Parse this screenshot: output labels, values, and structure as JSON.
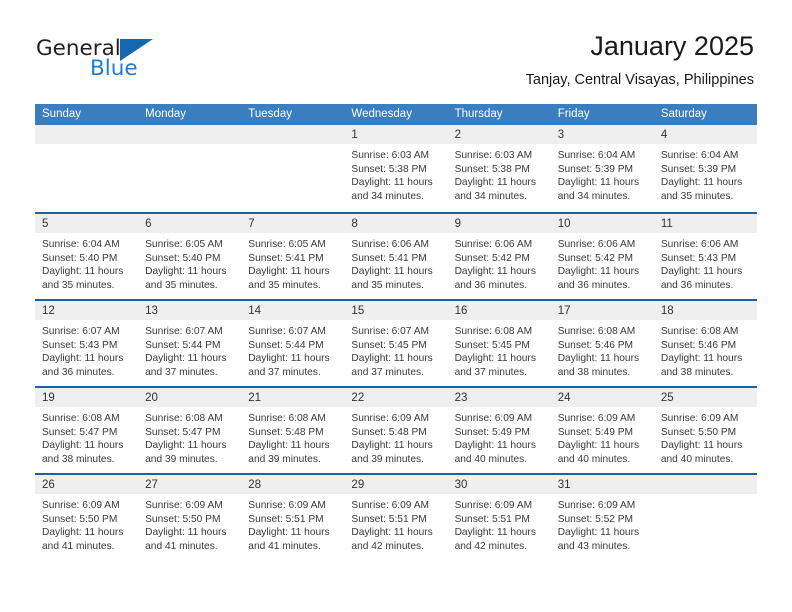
{
  "brand": {
    "name_part1": "General",
    "name_part2": "Blue",
    "accent_color": "#1567b0",
    "blue_text_color": "#1b7fd4"
  },
  "header": {
    "title": "January 2025",
    "subtitle": "Tanjay, Central Visayas, Philippines"
  },
  "theme": {
    "header_bar_color": "#3a7ec0",
    "week_divider_color": "#1f5fa3",
    "day_strip_color": "#efefef"
  },
  "weekdays": [
    "Sunday",
    "Monday",
    "Tuesday",
    "Wednesday",
    "Thursday",
    "Friday",
    "Saturday"
  ],
  "labels": {
    "sunrise_prefix": "Sunrise:",
    "sunset_prefix": "Sunset:",
    "daylight_prefix": "Daylight:"
  },
  "weeks": [
    [
      {
        "day": "",
        "empty": true
      },
      {
        "day": "",
        "empty": true
      },
      {
        "day": "",
        "empty": true
      },
      {
        "day": "1",
        "sunrise": "Sunrise: 6:03 AM",
        "sunset": "Sunset: 5:38 PM",
        "daylight1": "Daylight: 11 hours",
        "daylight2": "and 34 minutes."
      },
      {
        "day": "2",
        "sunrise": "Sunrise: 6:03 AM",
        "sunset": "Sunset: 5:38 PM",
        "daylight1": "Daylight: 11 hours",
        "daylight2": "and 34 minutes."
      },
      {
        "day": "3",
        "sunrise": "Sunrise: 6:04 AM",
        "sunset": "Sunset: 5:39 PM",
        "daylight1": "Daylight: 11 hours",
        "daylight2": "and 34 minutes."
      },
      {
        "day": "4",
        "sunrise": "Sunrise: 6:04 AM",
        "sunset": "Sunset: 5:39 PM",
        "daylight1": "Daylight: 11 hours",
        "daylight2": "and 35 minutes."
      }
    ],
    [
      {
        "day": "5",
        "sunrise": "Sunrise: 6:04 AM",
        "sunset": "Sunset: 5:40 PM",
        "daylight1": "Daylight: 11 hours",
        "daylight2": "and 35 minutes."
      },
      {
        "day": "6",
        "sunrise": "Sunrise: 6:05 AM",
        "sunset": "Sunset: 5:40 PM",
        "daylight1": "Daylight: 11 hours",
        "daylight2": "and 35 minutes."
      },
      {
        "day": "7",
        "sunrise": "Sunrise: 6:05 AM",
        "sunset": "Sunset: 5:41 PM",
        "daylight1": "Daylight: 11 hours",
        "daylight2": "and 35 minutes."
      },
      {
        "day": "8",
        "sunrise": "Sunrise: 6:06 AM",
        "sunset": "Sunset: 5:41 PM",
        "daylight1": "Daylight: 11 hours",
        "daylight2": "and 35 minutes."
      },
      {
        "day": "9",
        "sunrise": "Sunrise: 6:06 AM",
        "sunset": "Sunset: 5:42 PM",
        "daylight1": "Daylight: 11 hours",
        "daylight2": "and 36 minutes."
      },
      {
        "day": "10",
        "sunrise": "Sunrise: 6:06 AM",
        "sunset": "Sunset: 5:42 PM",
        "daylight1": "Daylight: 11 hours",
        "daylight2": "and 36 minutes."
      },
      {
        "day": "11",
        "sunrise": "Sunrise: 6:06 AM",
        "sunset": "Sunset: 5:43 PM",
        "daylight1": "Daylight: 11 hours",
        "daylight2": "and 36 minutes."
      }
    ],
    [
      {
        "day": "12",
        "sunrise": "Sunrise: 6:07 AM",
        "sunset": "Sunset: 5:43 PM",
        "daylight1": "Daylight: 11 hours",
        "daylight2": "and 36 minutes."
      },
      {
        "day": "13",
        "sunrise": "Sunrise: 6:07 AM",
        "sunset": "Sunset: 5:44 PM",
        "daylight1": "Daylight: 11 hours",
        "daylight2": "and 37 minutes."
      },
      {
        "day": "14",
        "sunrise": "Sunrise: 6:07 AM",
        "sunset": "Sunset: 5:44 PM",
        "daylight1": "Daylight: 11 hours",
        "daylight2": "and 37 minutes."
      },
      {
        "day": "15",
        "sunrise": "Sunrise: 6:07 AM",
        "sunset": "Sunset: 5:45 PM",
        "daylight1": "Daylight: 11 hours",
        "daylight2": "and 37 minutes."
      },
      {
        "day": "16",
        "sunrise": "Sunrise: 6:08 AM",
        "sunset": "Sunset: 5:45 PM",
        "daylight1": "Daylight: 11 hours",
        "daylight2": "and 37 minutes."
      },
      {
        "day": "17",
        "sunrise": "Sunrise: 6:08 AM",
        "sunset": "Sunset: 5:46 PM",
        "daylight1": "Daylight: 11 hours",
        "daylight2": "and 38 minutes."
      },
      {
        "day": "18",
        "sunrise": "Sunrise: 6:08 AM",
        "sunset": "Sunset: 5:46 PM",
        "daylight1": "Daylight: 11 hours",
        "daylight2": "and 38 minutes."
      }
    ],
    [
      {
        "day": "19",
        "sunrise": "Sunrise: 6:08 AM",
        "sunset": "Sunset: 5:47 PM",
        "daylight1": "Daylight: 11 hours",
        "daylight2": "and 38 minutes."
      },
      {
        "day": "20",
        "sunrise": "Sunrise: 6:08 AM",
        "sunset": "Sunset: 5:47 PM",
        "daylight1": "Daylight: 11 hours",
        "daylight2": "and 39 minutes."
      },
      {
        "day": "21",
        "sunrise": "Sunrise: 6:08 AM",
        "sunset": "Sunset: 5:48 PM",
        "daylight1": "Daylight: 11 hours",
        "daylight2": "and 39 minutes."
      },
      {
        "day": "22",
        "sunrise": "Sunrise: 6:09 AM",
        "sunset": "Sunset: 5:48 PM",
        "daylight1": "Daylight: 11 hours",
        "daylight2": "and 39 minutes."
      },
      {
        "day": "23",
        "sunrise": "Sunrise: 6:09 AM",
        "sunset": "Sunset: 5:49 PM",
        "daylight1": "Daylight: 11 hours",
        "daylight2": "and 40 minutes."
      },
      {
        "day": "24",
        "sunrise": "Sunrise: 6:09 AM",
        "sunset": "Sunset: 5:49 PM",
        "daylight1": "Daylight: 11 hours",
        "daylight2": "and 40 minutes."
      },
      {
        "day": "25",
        "sunrise": "Sunrise: 6:09 AM",
        "sunset": "Sunset: 5:50 PM",
        "daylight1": "Daylight: 11 hours",
        "daylight2": "and 40 minutes."
      }
    ],
    [
      {
        "day": "26",
        "sunrise": "Sunrise: 6:09 AM",
        "sunset": "Sunset: 5:50 PM",
        "daylight1": "Daylight: 11 hours",
        "daylight2": "and 41 minutes."
      },
      {
        "day": "27",
        "sunrise": "Sunrise: 6:09 AM",
        "sunset": "Sunset: 5:50 PM",
        "daylight1": "Daylight: 11 hours",
        "daylight2": "and 41 minutes."
      },
      {
        "day": "28",
        "sunrise": "Sunrise: 6:09 AM",
        "sunset": "Sunset: 5:51 PM",
        "daylight1": "Daylight: 11 hours",
        "daylight2": "and 41 minutes."
      },
      {
        "day": "29",
        "sunrise": "Sunrise: 6:09 AM",
        "sunset": "Sunset: 5:51 PM",
        "daylight1": "Daylight: 11 hours",
        "daylight2": "and 42 minutes."
      },
      {
        "day": "30",
        "sunrise": "Sunrise: 6:09 AM",
        "sunset": "Sunset: 5:51 PM",
        "daylight1": "Daylight: 11 hours",
        "daylight2": "and 42 minutes."
      },
      {
        "day": "31",
        "sunrise": "Sunrise: 6:09 AM",
        "sunset": "Sunset: 5:52 PM",
        "daylight1": "Daylight: 11 hours",
        "daylight2": "and 43 minutes."
      },
      {
        "day": "",
        "empty": true
      }
    ]
  ]
}
